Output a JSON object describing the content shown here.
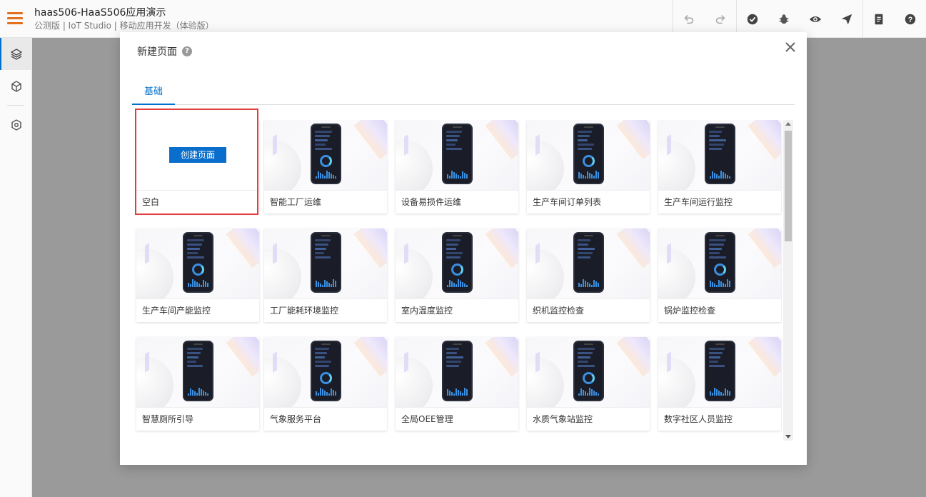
{
  "app": {
    "title": "haas506-HaaS506应用演示",
    "subtitle": "公测版 | IoT Studio | 移动应用开发（体验版）"
  },
  "toolbar": {
    "icons": [
      "undo-icon",
      "redo-icon",
      "check-icon",
      "bug-icon",
      "preview-eye-icon",
      "publish-send-icon",
      "document-icon",
      "help-icon"
    ]
  },
  "rail": {
    "items": [
      "layers-icon",
      "components-cube-icon",
      "settings-hexagon-icon"
    ]
  },
  "modal": {
    "title": "新建页面",
    "help": "?",
    "tab": "基础",
    "blank": {
      "button": "创建页面",
      "label": "空白"
    },
    "templates": [
      "智能工厂运维",
      "设备易损件运维",
      "生产车间订单列表",
      "生产车间运行监控",
      "生产车间产能监控",
      "工厂能耗环境监控",
      "室内温度监控",
      "织机监控检查",
      "锅炉监控检查",
      "智慧厕所引导",
      "气象服务平台",
      "全局OEE管理",
      "水质气象站监控",
      "数字社区人员监控"
    ]
  },
  "colors": {
    "accent": "#0070cc",
    "menu": "#e4701e",
    "highlight_border": "#e23c3c"
  }
}
